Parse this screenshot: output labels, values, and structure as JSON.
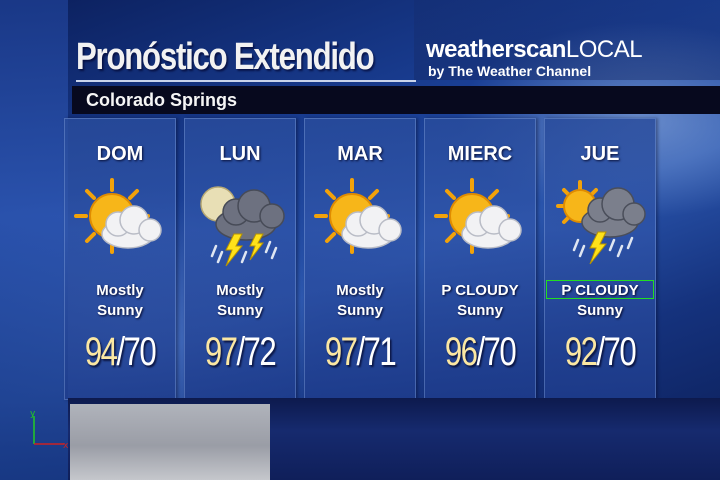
{
  "header": {
    "title": "Pronóstico Extendido",
    "brand_name_bold": "weatherscan",
    "brand_name_light": "LOCAL",
    "brand_sub": "by The Weather Channel"
  },
  "location": {
    "city": "Colorado Springs"
  },
  "forecast": [
    {
      "day": "DOM",
      "icon": "sun-partly-cloudy-icon",
      "cond_line1": "Mostly",
      "cond_line2": "Sunny",
      "high": "94",
      "low": "70"
    },
    {
      "day": "LUN",
      "icon": "moon-thunderstorm-icon",
      "cond_line1": "Mostly",
      "cond_line2": "Sunny",
      "high": "97",
      "low": "72"
    },
    {
      "day": "MAR",
      "icon": "sun-partly-cloudy-icon",
      "cond_line1": "Mostly",
      "cond_line2": "Sunny",
      "high": "97",
      "low": "71"
    },
    {
      "day": "MIERC",
      "icon": "sun-partly-cloudy-icon",
      "cond_line1": "P CLOUDY",
      "cond_line2": "Sunny",
      "high": "96",
      "low": "70"
    },
    {
      "day": "JUE",
      "icon": "sun-thunderstorm-icon",
      "cond_line1": "P CLOUDY",
      "cond_line2": "Sunny",
      "high": "92",
      "low": "70"
    }
  ],
  "temp_separator": "/",
  "axis_labels": {
    "x": "x",
    "y": "y"
  },
  "colors": {
    "high_temp": "#fbe7a2",
    "low_temp": "#ffffff",
    "highlight_box": "#22dd22",
    "city_bar": "#07091e"
  }
}
